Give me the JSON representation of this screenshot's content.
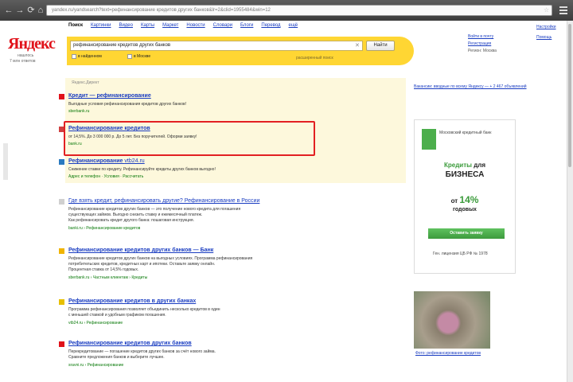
{
  "browser": {
    "back": "←",
    "forward": "→",
    "reload": "⟳",
    "home": "⌂",
    "address": "yandex.ru/yandsearch?text=рефинансирование кредитов других банков&lr=2&clid=1955484&win=12"
  },
  "logo": {
    "text": "Яндекс",
    "sub": "нашлось",
    "count": "7 млн ответов"
  },
  "tabs": [
    {
      "label": "Поиск"
    },
    {
      "label": "Картинки"
    },
    {
      "label": "Видео"
    },
    {
      "label": "Карты"
    },
    {
      "label": "Маркет"
    },
    {
      "label": "Новости"
    },
    {
      "label": "Словари"
    },
    {
      "label": "Блоги"
    },
    {
      "label": "Перевод"
    },
    {
      "label": "ещё"
    }
  ],
  "search": {
    "query": "рефинансирование кредитов других банков",
    "button": "Найти",
    "scope1": "в найденном",
    "scope2": "в Москве",
    "hint": "расширенный поиск"
  },
  "user": {
    "login": "Войти в почту",
    "register": "Регистрация",
    "region": "Москва",
    "region_label": "Регион:"
  },
  "settings": {
    "s1": "Настройки",
    "s2": "Помощь"
  },
  "ads": {
    "label": "Яндекс.Директ",
    "items": [
      {
        "title": "Кредит — рефинансирование",
        "text": "Выгодные условия рефинансирования кредитов других банков!",
        "url": "sberbank.ru"
      },
      {
        "title": "Рефинансирование кредитов",
        "text": "от 14,5%. До 3 000 000 р. До 5 лет. Без поручителей. Оформи заявку!",
        "url": "bank.ru"
      },
      {
        "title": "Рефинансирование",
        "url_inline": "vtb24.ru",
        "text": "Снижение ставки по кредиту. Рефинансируйте кредиты других банков выгодно!",
        "links": "Адрес и телефон · Условия · Рассчитать"
      }
    ]
  },
  "results": [
    {
      "title": "Где взять кредит, рефинансировать другие? Рефинансирование в России",
      "text1": "Рефинансирование кредитов других банков — это получение нового кредита для погашения",
      "text2": "существующих займов. Выгодно снизить ставку и ежемесячный платеж.",
      "text3": "Как рефинансировать кредит другого банка: пошаговая инструкция.",
      "url": "banki.ru › Рефинансирование кредитов"
    },
    {
      "title": "Рефинансирование кредитов других банков — Банк",
      "text1": "Рефинансирование кредитов других банков на выгодных условиях. Программа рефинансирования",
      "text2": "потребительских кредитов, кредитных карт и ипотеки. Оставьте заявку онлайн.",
      "text3": "Процентная ставка от 14,5% годовых.",
      "url": "sberbank.ru › Частным клиентам › Кредиты"
    },
    {
      "title": "Рефинансирование кредитов в других банках",
      "text1": "Программа рефинансирования позволяет объединить несколько кредитов в один",
      "text2": "с меньшей ставкой и удобным графиком погашения.",
      "url": "vtb24.ru › Рефинансирование"
    },
    {
      "title": "Рефинансирование кредитов других банков",
      "text1": "Перекредитование — погашение кредитов других банков за счёт нового займа.",
      "text2": "Сравните предложения банков и выберите лучшее.",
      "url": "sravni.ru › Рефинансирование"
    }
  ],
  "right": {
    "link": "Вакансии: вводные по всему Яндексу — + 2 467 объявлений",
    "bank_name": "Московский кредитный банк",
    "banner_h1a": "Кредиты",
    "banner_h1b": "для",
    "banner_h2": "БИЗНЕСА",
    "banner_h3a": "от",
    "banner_h3b": "14%",
    "banner_h4": "годовых",
    "banner_btn": "Оставить заявку",
    "banner_note": "Ген. лицензия ЦБ РФ № 1978",
    "photo_caption": "Фото: рефинансирование кредитов"
  }
}
